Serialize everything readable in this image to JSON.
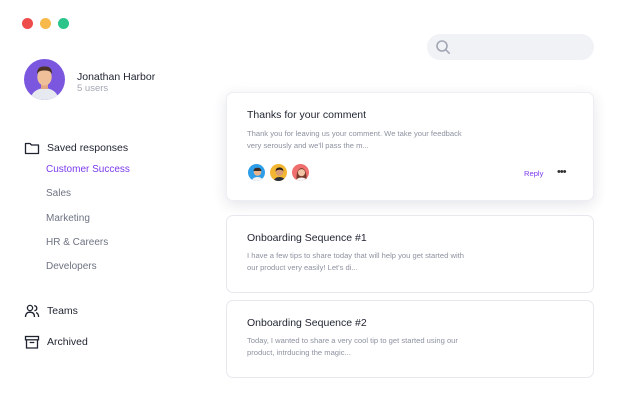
{
  "window": {
    "dot_colors": [
      "#ee4b4b",
      "#f6b94a",
      "#2bc48a"
    ]
  },
  "search": {
    "placeholder": "",
    "value": "",
    "icon": "search-icon"
  },
  "user": {
    "name": "Jonathan Harbor",
    "subtitle": "5 users"
  },
  "sidebar": {
    "saved_responses": {
      "icon": "folder-icon",
      "label": "Saved responses",
      "items": [
        {
          "label": "Customer Success",
          "active": true
        },
        {
          "label": "Sales",
          "active": false
        },
        {
          "label": "Marketing",
          "active": false
        },
        {
          "label": "HR & Careers",
          "active": false
        },
        {
          "label": "Developers",
          "active": false
        }
      ]
    },
    "teams": {
      "icon": "users-icon",
      "label": "Teams"
    },
    "archived": {
      "icon": "archive-icon",
      "label": "Archived"
    }
  },
  "cards": [
    {
      "title": "Thanks for your comment",
      "body": "Thank you for leaving us your comment. We take your feedback very serously and we'll pass the m...",
      "reply_label": "Reply",
      "more_label": "•••"
    },
    {
      "title": "Onboarding Sequence #1",
      "body": "I have a few tips to share today that will help you get started with our product very easily! Let's di..."
    },
    {
      "title": "Onboarding Sequence #2",
      "body": "Today, I wanted to share a very cool tip to get started using our product, intrducing the magic..."
    }
  ],
  "colors": {
    "accent": "#7c3aed",
    "text": "#1f2330",
    "muted": "#8d92a0"
  }
}
